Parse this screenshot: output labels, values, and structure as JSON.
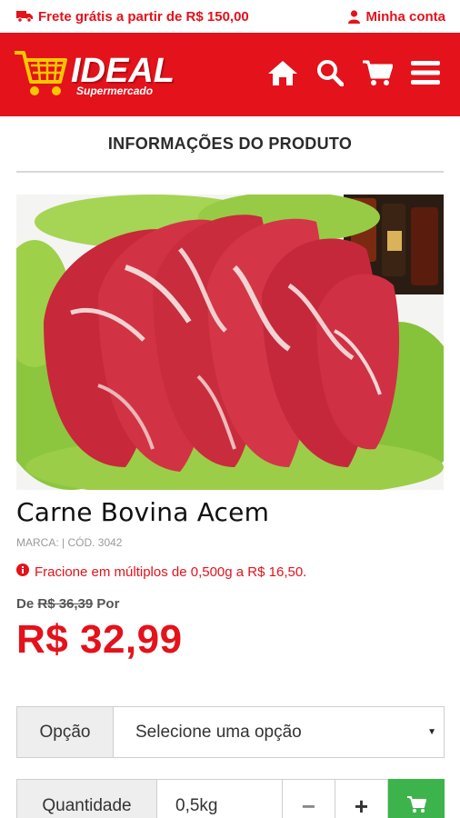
{
  "topbar": {
    "shipping_text": "Frete grátis a partir de R$ 150,00",
    "account_text": "Minha conta"
  },
  "header": {
    "logo_main": "IDEAL",
    "logo_sub": "Supermercado",
    "nav_icons": [
      "home-icon",
      "search-icon",
      "cart-icon",
      "menu-icon"
    ]
  },
  "section": {
    "title": "INFORMAÇÕES DO PRODUTO"
  },
  "product": {
    "name": "Carne Bovina Acem",
    "meta": "MARCA: | CÓD. 3042",
    "fraction_notice": "Fracione em múltiplos de 0,500g a R$ 16,50.",
    "old_price_prefix": "De",
    "old_price": "R$ 36,39",
    "old_price_suffix": "Por",
    "price": "R$ 32,99"
  },
  "option": {
    "label": "Opção",
    "selected": "Selecione uma opção"
  },
  "quantity": {
    "label": "Quantidade",
    "value": "0,5kg",
    "minus": "−",
    "plus": "+"
  },
  "colors": {
    "brand_red": "#e3121b",
    "cart_green": "#3cb44b"
  }
}
